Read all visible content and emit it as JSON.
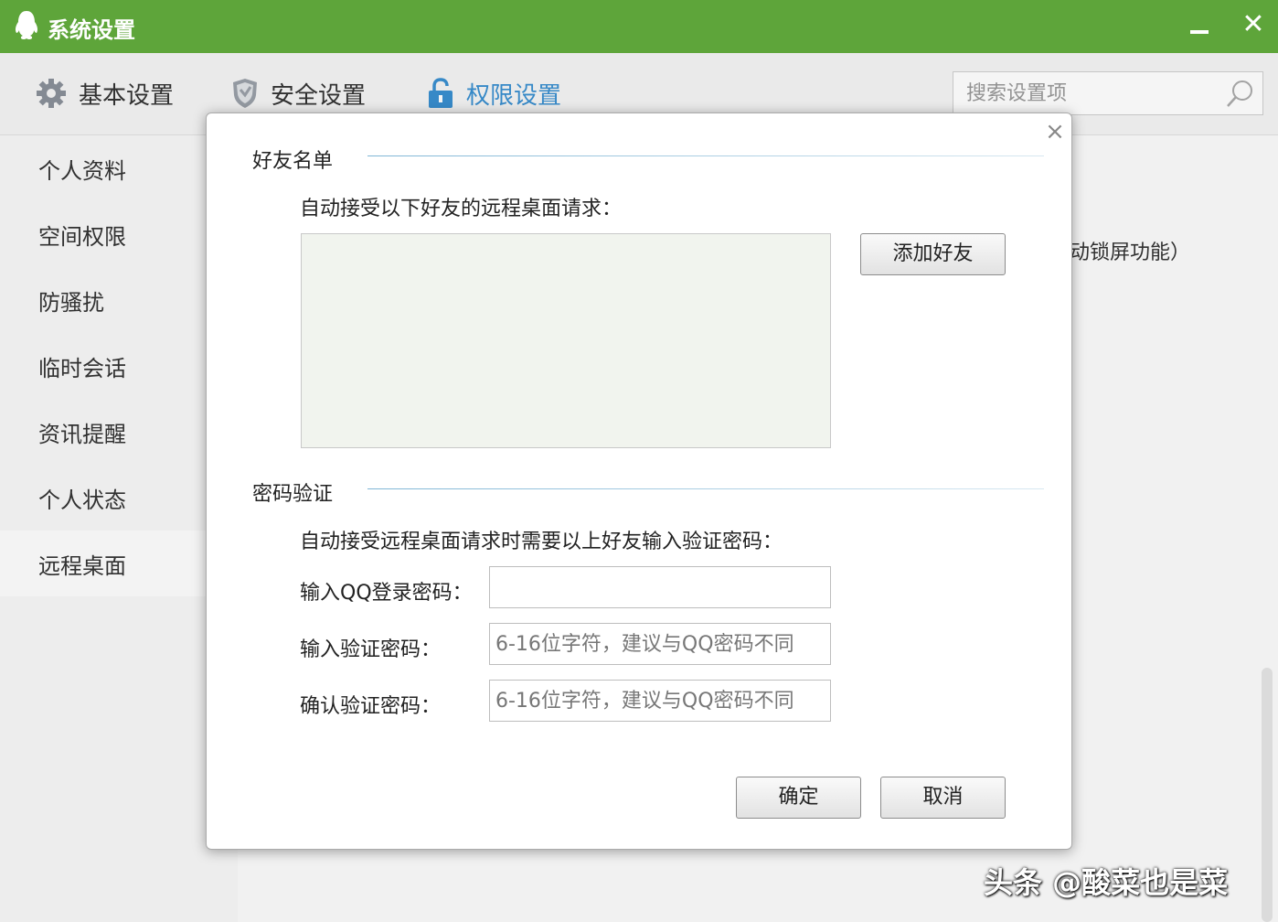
{
  "window": {
    "title": "系统设置"
  },
  "topnav": {
    "tabs": [
      {
        "label": "基本设置",
        "icon": "gear-icon"
      },
      {
        "label": "安全设置",
        "icon": "shield-icon"
      },
      {
        "label": "权限设置",
        "icon": "lock-icon",
        "active": true
      }
    ],
    "search_placeholder": "搜索设置项"
  },
  "sidebar": {
    "items": [
      {
        "label": "个人资料"
      },
      {
        "label": "空间权限"
      },
      {
        "label": "防骚扰"
      },
      {
        "label": "临时会话"
      },
      {
        "label": "资讯提醒"
      },
      {
        "label": "个人状态"
      },
      {
        "label": "远程桌面",
        "active": true
      }
    ]
  },
  "background": {
    "partial_text": "动锁屏功能）"
  },
  "dialog": {
    "friends_section": {
      "title": "好友名单",
      "description": "自动接受以下好友的远程桌面请求：",
      "add_button": "添加好友"
    },
    "password_section": {
      "title": "密码验证",
      "description": "自动接受远程桌面请求时需要以上好友输入验证密码：",
      "qq_password_label": "输入QQ登录密码：",
      "qq_password_value": "",
      "verify_password_label": "输入验证密码：",
      "verify_password_placeholder": "6-16位字符，建议与QQ密码不同",
      "confirm_password_label": "确认验证密码：",
      "confirm_password_placeholder": "6-16位字符，建议与QQ密码不同"
    },
    "ok_button": "确定",
    "cancel_button": "取消"
  },
  "watermark": "头条 @酸菜也是菜",
  "colors": {
    "titlebar": "#5ea53a",
    "accent": "#3a8fd0"
  }
}
